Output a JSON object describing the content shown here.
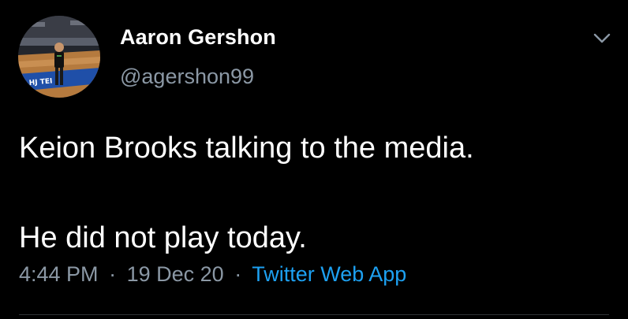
{
  "tweet": {
    "author": {
      "display_name": "Aaron Gershon",
      "handle": "@agershon99",
      "avatar_icon": "profile-photo"
    },
    "text": "Keion Brooks talking to the media.\n\nHe did not play today.",
    "meta": {
      "time": "4:44 PM",
      "separator": "·",
      "date": "19 Dec 20",
      "source": "Twitter Web App"
    },
    "more_icon": "chevron-down-icon"
  },
  "colors": {
    "background": "#000000",
    "text_primary": "#ffffff",
    "text_secondary": "#8b98a5",
    "link": "#1da1f2",
    "divider": "#2f3336"
  }
}
